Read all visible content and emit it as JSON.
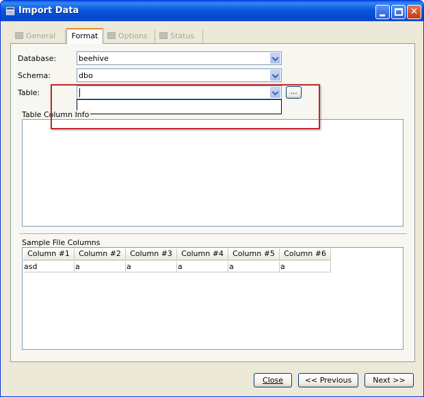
{
  "window": {
    "title": "Import Data"
  },
  "title_buttons": {
    "minimize_icon": "minimize-icon",
    "maximize_icon": "maximize-icon",
    "close_icon": "close-icon",
    "close_glyph": "✕"
  },
  "tabs": [
    {
      "label": "General",
      "state": "disabled",
      "icon": "general-tab-icon"
    },
    {
      "label": "Format",
      "state": "active"
    },
    {
      "label": "Options",
      "state": "disabled",
      "icon": "options-tab-icon"
    },
    {
      "label": "Status",
      "state": "disabled",
      "icon": "status-tab-icon"
    }
  ],
  "form": {
    "database_label": "Database:",
    "database_value": "beehive",
    "schema_label": "Schema:",
    "schema_value": "dbo",
    "table_label": "Table:",
    "table_value": "",
    "browse_label": "..."
  },
  "table_column_info": {
    "label": "Table Column Info"
  },
  "sample_file_columns": {
    "label": "Sample File Columns",
    "columns": [
      "Column #1",
      "Column #2",
      "Column #3",
      "Column #4",
      "Column #5",
      "Column #6"
    ],
    "rows": [
      [
        "asd",
        "a",
        "a",
        "a",
        "a",
        "a"
      ]
    ]
  },
  "buttons": {
    "close_label": "Close",
    "previous_label": "<< Previous",
    "next_label": "Next >>"
  },
  "colors": {
    "titlebar": "#0a58dd",
    "highlight": "#c4252a",
    "active_tab_accent": "#e68b2c",
    "window_bg": "#ece9d8"
  }
}
